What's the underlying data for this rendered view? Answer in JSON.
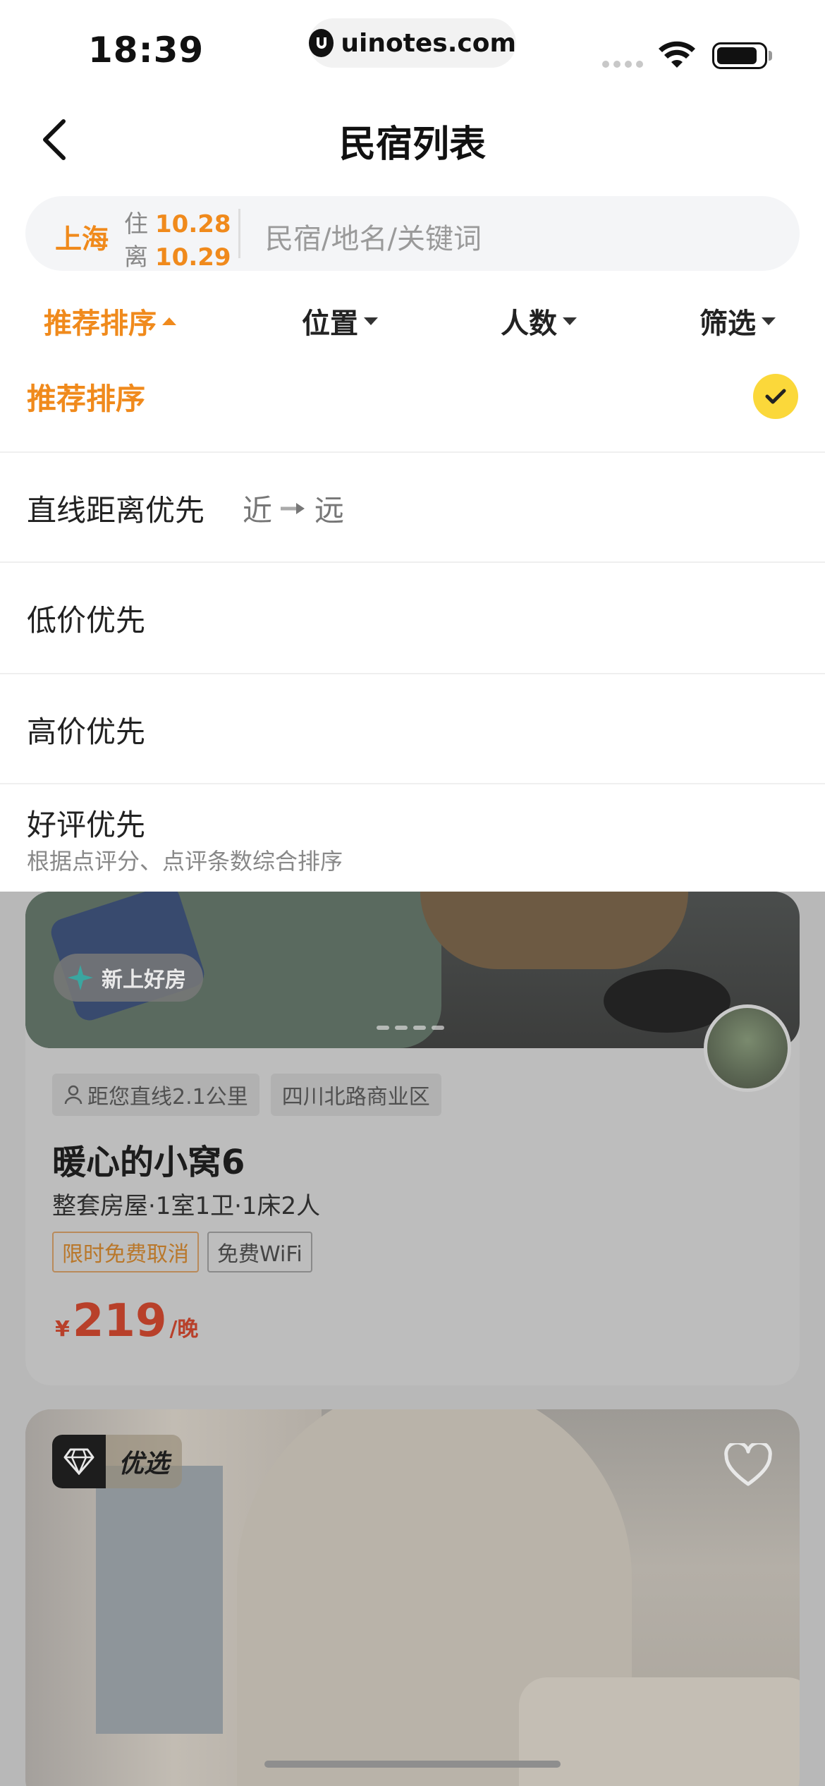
{
  "status_bar": {
    "time": "18:39",
    "url": "uinotes.com",
    "url_logo_icon": "uinotes-logo-icon"
  },
  "header": {
    "title": "民宿列表"
  },
  "search": {
    "city": "上海",
    "checkin_label": "住",
    "checkin_date": "10.28",
    "checkout_label": "离",
    "checkout_date": "10.29",
    "placeholder": "民宿/地名/关键词"
  },
  "filter_tabs": [
    {
      "label": "推荐排序",
      "active": true
    },
    {
      "label": "位置",
      "active": false
    },
    {
      "label": "人数",
      "active": false
    },
    {
      "label": "筛选",
      "active": false
    }
  ],
  "sort_options": {
    "recommended": "推荐排序",
    "distance": "直线距离优先",
    "distance_near": "近",
    "distance_far": "远",
    "low_price": "低价优先",
    "high_price": "高价优先",
    "rating": "好评优先",
    "rating_desc": "根据点评分、点评条数综合排序"
  },
  "listing_1": {
    "badge": "新上好房",
    "distance": "距您直线2.1公里",
    "area": "四川北路商业区",
    "title": "暖心的小窝6",
    "subtitle": "整套房屋·1室1卫·1床2人",
    "chips": [
      "限时免费取消",
      "免费WiFi"
    ],
    "currency": "¥",
    "price": "219",
    "unit": "/晚"
  },
  "listing_2": {
    "badge": "优选"
  },
  "colors": {
    "accent": "#f08a1c",
    "check_bg": "#fbd83a",
    "overlay": "#b8b8b8"
  }
}
